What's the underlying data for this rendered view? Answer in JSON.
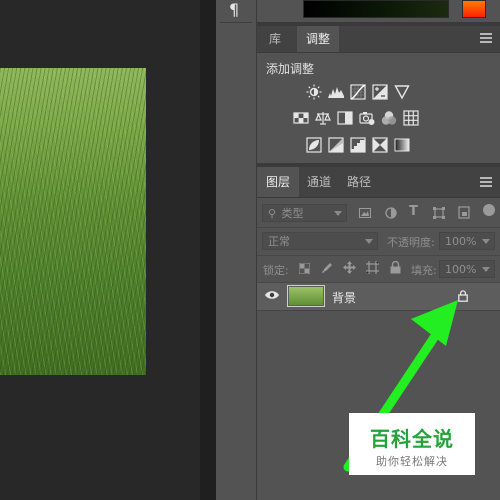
{
  "dock": {
    "paragraph_icon": "¶"
  },
  "panel_top": {
    "tabs": [
      {
        "label": "库"
      },
      {
        "label": "调整"
      }
    ],
    "active_tab": "调整"
  },
  "adjustments": {
    "title": "添加调整",
    "icons_row1": [
      "brightness-contrast-icon",
      "levels-icon",
      "curves-icon",
      "exposure-icon",
      "vibrance-icon"
    ],
    "icons_row2": [
      "hue-saturation-icon",
      "color-balance-icon",
      "black-white-icon",
      "photo-filter-icon",
      "channel-mixer-icon",
      "color-lookup-icon"
    ],
    "icons_row3": [
      "invert-icon",
      "posterize-icon",
      "threshold-icon",
      "selective-color-icon",
      "gradient-map-icon"
    ]
  },
  "layers_panel": {
    "tabs": [
      {
        "label": "图层"
      },
      {
        "label": "通道"
      },
      {
        "label": "路径"
      }
    ],
    "active_tab": "图层",
    "filter": {
      "placeholder": "类型",
      "icon": "search-icon"
    },
    "blend_mode": "正常",
    "opacity_label": "不透明度:",
    "opacity_value": "100%",
    "lock_label": "锁定:",
    "fill_label": "填充:",
    "fill_value": "100%",
    "layers": [
      {
        "name": "背景",
        "visible": true,
        "locked": true
      }
    ]
  },
  "watermark": {
    "title": "百科全说",
    "subtitle": "助你轻松解决"
  },
  "colors": {
    "annotation_arrow": "#22ee22",
    "brand_green": "#25a23a"
  }
}
